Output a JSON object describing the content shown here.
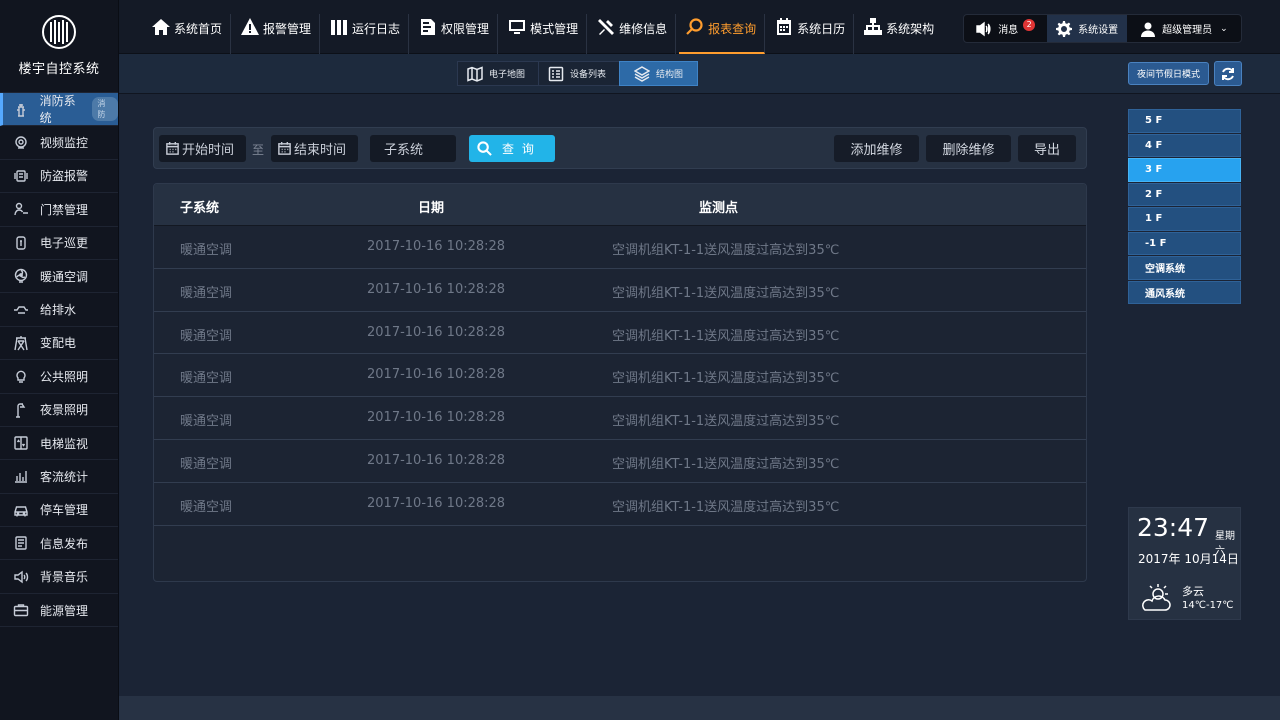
{
  "app": {
    "title": "楼宇自控系统"
  },
  "sidebar": {
    "items": [
      {
        "label": "消防系统",
        "badge": "消防",
        "icon": "fire-hydrant-icon",
        "active": true
      },
      {
        "label": "视频监控",
        "icon": "camera-icon"
      },
      {
        "label": "防盗报警",
        "icon": "alarm-icon"
      },
      {
        "label": "门禁管理",
        "icon": "door-icon"
      },
      {
        "label": "电子巡更",
        "icon": "patrol-icon"
      },
      {
        "label": "暖通空调",
        "icon": "fan-icon"
      },
      {
        "label": "给排水",
        "icon": "pipe-icon"
      },
      {
        "label": "变配电",
        "icon": "power-tower-icon"
      },
      {
        "label": "公共照明",
        "icon": "bulb-icon"
      },
      {
        "label": "夜景照明",
        "icon": "street-lamp-icon"
      },
      {
        "label": "电梯监视",
        "icon": "elevator-icon"
      },
      {
        "label": "客流统计",
        "icon": "bar-chart-icon"
      },
      {
        "label": "停车管理",
        "icon": "car-icon"
      },
      {
        "label": "信息发布",
        "icon": "document-icon"
      },
      {
        "label": "背景音乐",
        "icon": "speaker-icon"
      },
      {
        "label": "能源管理",
        "icon": "briefcase-icon"
      }
    ]
  },
  "topnav": {
    "items": [
      {
        "label": "系统首页",
        "icon": "home-icon"
      },
      {
        "label": "报警管理",
        "icon": "warning-icon"
      },
      {
        "label": "运行日志",
        "icon": "log-icon"
      },
      {
        "label": "权限管理",
        "icon": "permission-icon"
      },
      {
        "label": "模式管理",
        "icon": "monitor-icon"
      },
      {
        "label": "维修信息",
        "icon": "tools-icon"
      },
      {
        "label": "报表查询",
        "icon": "search-icon",
        "active": true
      },
      {
        "label": "系统日历",
        "icon": "calendar-icon"
      },
      {
        "label": "系统架构",
        "icon": "hierarchy-icon"
      }
    ]
  },
  "toolbox": {
    "messages_label": "消息",
    "messages_count": "2",
    "settings_label": "系统设置",
    "user_label": "超级管理员"
  },
  "subtabs": {
    "items": [
      {
        "label": "电子地图",
        "icon": "map-icon"
      },
      {
        "label": "设备列表",
        "icon": "list-icon"
      },
      {
        "label": "结构图",
        "icon": "layers-icon",
        "active": true
      }
    ],
    "mode_button": "夜间节假日模式"
  },
  "filter": {
    "start_placeholder": "开始时间",
    "to_label": "至",
    "end_placeholder": "结束时间",
    "subsystem_placeholder": "子系统",
    "query_label": "查 询",
    "add_label": "添加维修",
    "delete_label": "删除维修",
    "export_label": "导出"
  },
  "table": {
    "headers": {
      "subsystem": "子系统",
      "date": "日期",
      "point": "监测点"
    },
    "rows": [
      {
        "subsystem": "暖通空调",
        "date": "2017-10-16  10:28:28",
        "point": "空调机组KT-1-1送风温度过高达到35℃"
      },
      {
        "subsystem": "暖通空调",
        "date": "2017-10-16  10:28:28",
        "point": "空调机组KT-1-1送风温度过高达到35℃"
      },
      {
        "subsystem": "暖通空调",
        "date": "2017-10-16  10:28:28",
        "point": "空调机组KT-1-1送风温度过高达到35℃"
      },
      {
        "subsystem": "暖通空调",
        "date": "2017-10-16  10:28:28",
        "point": "空调机组KT-1-1送风温度过高达到35℃"
      },
      {
        "subsystem": "暖通空调",
        "date": "2017-10-16  10:28:28",
        "point": "空调机组KT-1-1送风温度过高达到35℃"
      },
      {
        "subsystem": "暖通空调",
        "date": "2017-10-16  10:28:28",
        "point": "空调机组KT-1-1送风温度过高达到35℃"
      },
      {
        "subsystem": "暖通空调",
        "date": "2017-10-16  10:28:28",
        "point": "空调机组KT-1-1送风温度过高达到35℃"
      }
    ]
  },
  "floors": {
    "items": [
      {
        "label": "5 F"
      },
      {
        "label": "4 F"
      },
      {
        "label": "3 F",
        "active": true
      },
      {
        "label": "2 F"
      },
      {
        "label": "1 F"
      },
      {
        "label": "-1 F"
      },
      {
        "label": "空调系统"
      },
      {
        "label": "通风系统"
      }
    ]
  },
  "clock": {
    "time": "23:47",
    "weekday": "星期六",
    "date": "2017年 10月14日",
    "condition": "多云",
    "temperature": "14℃-17℃"
  },
  "colors": {
    "accent_active_nav": "#ff9d2e",
    "query_button": "#22b4e8",
    "floor_active": "#27a2ef",
    "sidebar_active": "#2a5d95"
  }
}
